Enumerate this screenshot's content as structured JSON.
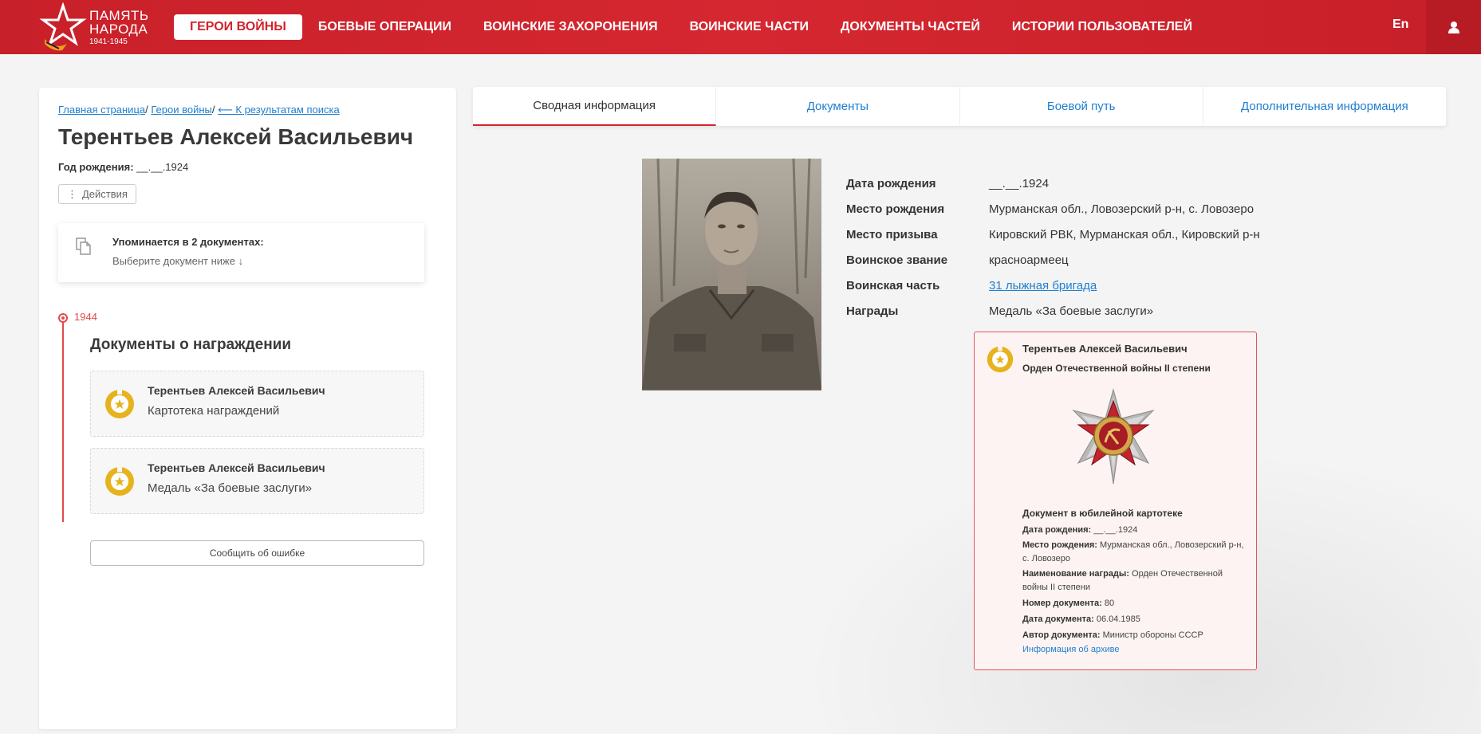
{
  "header": {
    "logo": {
      "line1": "ПАМЯТЬ",
      "line2": "НАРОДА",
      "line3": "1941-1945"
    },
    "nav": [
      {
        "label": "Герои войны",
        "active": true
      },
      {
        "label": "Боевые операции",
        "active": false
      },
      {
        "label": "Воинские захоронения",
        "active": false
      },
      {
        "label": "Воинские части",
        "active": false
      },
      {
        "label": "Документы частей",
        "active": false
      },
      {
        "label": "Истории пользователей",
        "active": false
      }
    ],
    "lang": "En",
    "user_icon": "user-icon"
  },
  "sidebar": {
    "breadcrumb": {
      "home": "Главная страница",
      "sep": "/",
      "heroes": "Герои войны",
      "back": "⟵ К результатам поиска"
    },
    "name": "Терентьев Алексей Васильевич",
    "birth_label": "Год рождения:",
    "birth_value": "__.__.1924",
    "actions_label": "Действия",
    "mentions": {
      "title": "Упоминается в 2 документах:",
      "subtitle": "Выберите документ ниже ↓"
    },
    "timeline_year": "1944",
    "docs_title": "Документы о награждении",
    "doc_cards": [
      {
        "name": "Терентьев Алексей Васильевич",
        "subtitle": "Картотека награждений"
      },
      {
        "name": "Терентьев Алексей Васильевич",
        "subtitle": "Медаль «За боевые заслуги»"
      }
    ],
    "report_error": "Сообщить об ошибке"
  },
  "tabs": [
    {
      "label": "Сводная информация",
      "active": true
    },
    {
      "label": "Документы",
      "active": false
    },
    {
      "label": "Боевой путь",
      "active": false
    },
    {
      "label": "Дополнительная информация",
      "active": false
    }
  ],
  "info": [
    {
      "label": "Дата рождения",
      "value": "__.__.1924"
    },
    {
      "label": "Место рождения",
      "value": "Мурманская обл., Ловозерский р-н, с. Ловозеро"
    },
    {
      "label": "Место призыва",
      "value": "Кировский РВК, Мурманская обл., Кировский р-н"
    },
    {
      "label": "Воинское звание",
      "value": "красноармеец"
    },
    {
      "label": "Воинская часть",
      "value": "31 лыжная бригада",
      "link": true
    },
    {
      "label": "Награды",
      "value": "Медаль «За боевые заслуги»"
    }
  ],
  "award_card": {
    "name": "Терентьев Алексей Васильевич",
    "order": "Орден Отечественной войны II степени",
    "doc_title": "Документ в юбилейной картотеке",
    "lines": [
      {
        "label": "Дата рождения:",
        "value": "__.__.1924"
      },
      {
        "label": "Место рождения:",
        "value": "Мурманская обл., Ловозерский р-н, с. Ловозеро"
      },
      {
        "label": "Наименование награды:",
        "value": "Орден Отечественной войны II степени"
      },
      {
        "label": "Номер документа:",
        "value": "80"
      },
      {
        "label": "Дата документа:",
        "value": "06.04.1985"
      },
      {
        "label": "Автор документа:",
        "value": "Министр обороны СССР"
      }
    ],
    "archive_link": "Информация об архиве"
  },
  "colors": {
    "brand_red": "#d2232c",
    "link_blue": "#1f7fd0",
    "medal_gold": "#e6b31e"
  }
}
